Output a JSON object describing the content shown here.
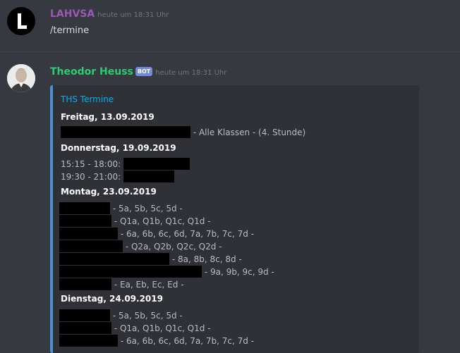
{
  "messages": [
    {
      "author": "LAHVSA",
      "timestamp": "heute um 18:31 Uhr",
      "text": "/termine"
    },
    {
      "author": "Theodor Heuss",
      "bot_tag": "BOT",
      "timestamp": "heute um 18:31 Uhr"
    }
  ],
  "embed": {
    "title": "THS Termine",
    "days": {
      "d1": "Freitag, 13.09.2019",
      "d2": "Donnerstag, 19.09.2019",
      "d3": "Montag, 23.09.2019",
      "d4": "Dienstag, 24.09.2019"
    },
    "lines": {
      "l1": "- Alle Klassen - (4. Stunde)",
      "l2": "15:15 - 18:00:",
      "l3": "19:30 - 21:00:",
      "l4": "- 5a, 5b, 5c, 5d -",
      "l5": "- Q1a, Q1b, Q1c, Q1d -",
      "l6": "- 6a, 6b, 6c, 6d, 7a, 7b, 7c, 7d -",
      "l7": "- Q2a, Q2b, Q2c, Q2d -",
      "l8": "- 8a, 8b, 8c, 8d -",
      "l9": "- 9a, 9b, 9c, 9d -",
      "l10": "- Ea, Eb, Ec, Ed -",
      "l11": "- 5a, 5b, 5c, 5d -",
      "l12": "- Q1a, Q1b, Q1c, Q1d -",
      "l13": "- 6a, 6b, 6c, 6d, 7a, 7b, 7c, 7d -"
    }
  },
  "colors": {
    "background": "#36393f",
    "user_name": "#9b59b6",
    "bot_name": "#2ecc71",
    "embed_accent": "#4a90d9",
    "embed_title": "#00b0f4",
    "bot_tag": "#7289da"
  },
  "icons": {
    "user_avatar": "letter-L-avatar-icon",
    "bot_avatar": "portrait-avatar-icon"
  }
}
